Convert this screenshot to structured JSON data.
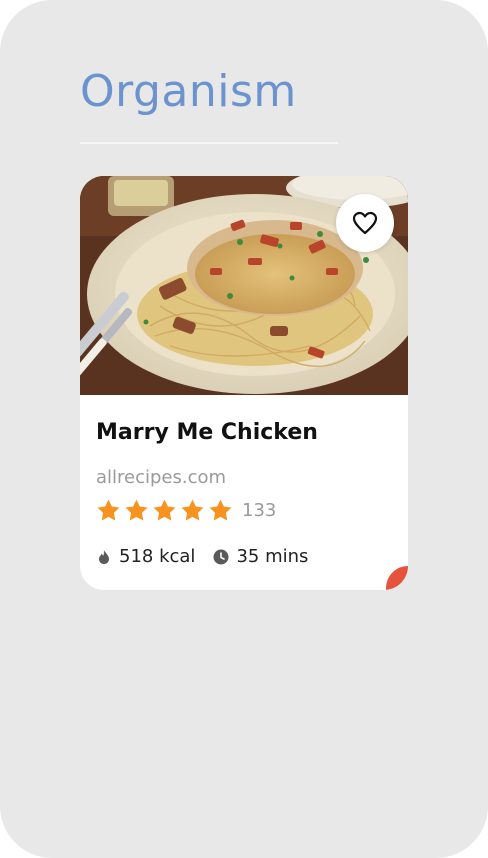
{
  "page": {
    "title": "Organism"
  },
  "card": {
    "title": "Marry Me Chicken",
    "source": "allrecipes.com",
    "rating": {
      "stars": 5,
      "max": 5,
      "count": "133"
    },
    "calories": "518 kcal",
    "time": "35 mins"
  },
  "icons": {
    "favorite": "heart-outline-icon",
    "calories": "flame-icon",
    "time": "clock-icon",
    "rating": "star-icon"
  },
  "colors": {
    "title": "#6a93cf",
    "star": "#f7931e",
    "accent_dot": "#e5533d",
    "background": "#e8e8e8"
  }
}
